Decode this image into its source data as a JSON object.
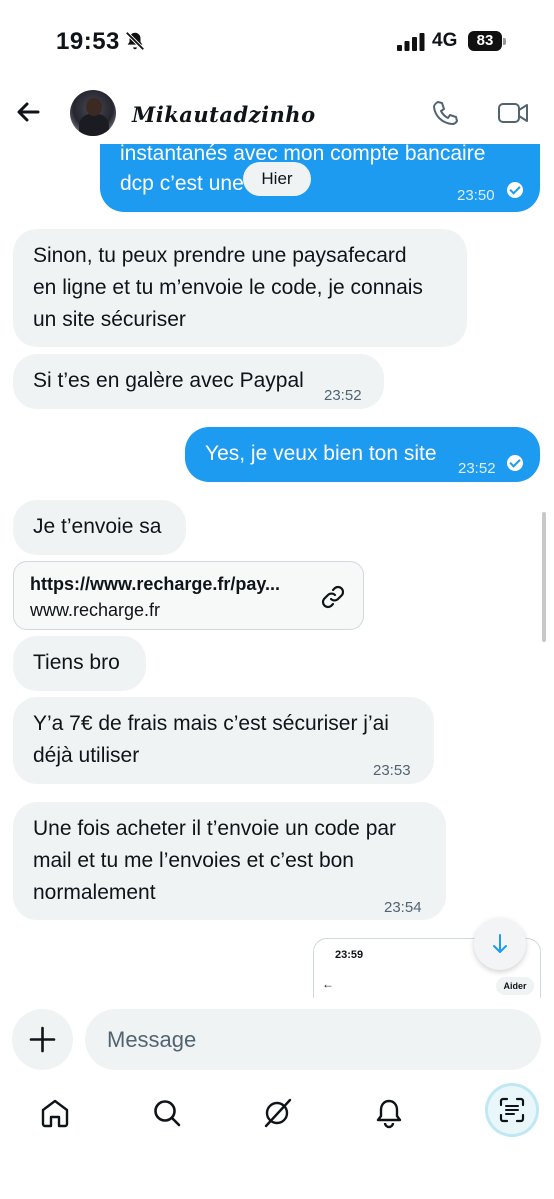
{
  "status_bar": {
    "time": "19:53",
    "network": "4G",
    "battery": "83"
  },
  "header": {
    "contact_name": "Mikautadzinho"
  },
  "date_divider": "Hier",
  "messages": [
    {
      "direction": "out",
      "lines": [
        "instantanés avec mon compte bancaire",
        "dcp c’est une galère"
      ],
      "time": "23:50"
    },
    {
      "direction": "in",
      "lines": [
        "Sinon, tu peux prendre une paysafecard",
        "en ligne et tu m’envoie le code, je connais",
        "un site sécuriser"
      ]
    },
    {
      "direction": "in",
      "lines": [
        "Si t’es en galère avec Paypal"
      ],
      "time": "23:52"
    },
    {
      "direction": "out",
      "lines": [
        "Yes, je veux bien ton site"
      ],
      "time": "23:52"
    },
    {
      "direction": "in",
      "lines": [
        "Je t’envoie sa"
      ]
    },
    {
      "direction": "in",
      "lines": [
        "Tiens bro"
      ]
    },
    {
      "direction": "in",
      "lines": [
        "Y’a 7€ de frais mais c’est sécuriser j’ai",
        "déjà utiliser"
      ],
      "time": "23:53"
    },
    {
      "direction": "in",
      "lines": [
        "Une fois acheter il t’envoie un code par",
        "mail et tu me l’envoies et c’est bon",
        "normalement"
      ],
      "time": "23:54"
    }
  ],
  "link_card": {
    "title": "https://www.recharge.fr/pay...",
    "domain": "www.recharge.fr"
  },
  "screenshot_preview": {
    "time": "23:59",
    "button": "Aider"
  },
  "composer": {
    "placeholder": "Message"
  },
  "icons": {
    "back": "arrow-left-icon",
    "call": "phone-icon",
    "video": "video-icon",
    "link": "link-icon",
    "plus": "plus-icon",
    "home": "home-icon",
    "search": "search-icon",
    "grok": "grok-icon",
    "notifications": "bell-icon",
    "scan": "scan-text-icon",
    "scroll_down": "arrow-down-icon"
  },
  "colors": {
    "accent": "#1d9bf0",
    "incoming_bubble": "#eff3f4",
    "text": "#0f1419",
    "secondary_text": "#536471"
  }
}
